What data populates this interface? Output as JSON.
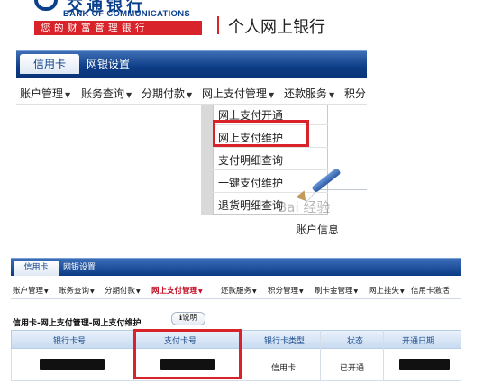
{
  "top": {
    "logo_cn_partial": "交通银行",
    "logo_en": "BANK OF COMMUNICATIONS",
    "slogan": "您的财富管理银行",
    "personal_banking": "个人网上银行",
    "tabs": {
      "credit_card": "信用卡",
      "net_settings": "网银设置"
    },
    "menu": [
      {
        "label": "账户管理"
      },
      {
        "label": "账务查询"
      },
      {
        "label": "分期付款"
      },
      {
        "label": "网上支付管理"
      },
      {
        "label": "还款服务"
      },
      {
        "label": "积分"
      }
    ],
    "dropdown": [
      {
        "label": "网上支付开通"
      },
      {
        "label": "网上支付维护"
      },
      {
        "label": "支付明细查询"
      },
      {
        "label": "一键支付维护"
      },
      {
        "label": "退货明细查询"
      }
    ],
    "account_info": "账户信息",
    "watermark": "Bai 经验"
  },
  "bottom": {
    "tabs": {
      "credit_card": "信用卡",
      "net_settings": "网银设置"
    },
    "menu": [
      {
        "label": "账户管理"
      },
      {
        "label": "账务查询"
      },
      {
        "label": "分期付款"
      },
      {
        "label": "网上支付管理"
      },
      {
        "label": "还款服务"
      },
      {
        "label": "积分管理"
      },
      {
        "label": "刷卡金管理"
      },
      {
        "label": "网上挂失"
      },
      {
        "label": "信用卡激活"
      }
    ],
    "breadcrumb": "信用卡-网上支付管理-网上支付维护",
    "help_button": "说明",
    "table": {
      "headers": [
        "银行卡号",
        "支付卡号",
        "银行卡类型",
        "状态",
        "开通日期"
      ],
      "row": {
        "card_type": "信用卡",
        "status": "已开通"
      }
    }
  },
  "colors": {
    "brand_blue": "#0a3f8c",
    "brand_red": "#d8232a",
    "highlight": "#d8232a"
  }
}
